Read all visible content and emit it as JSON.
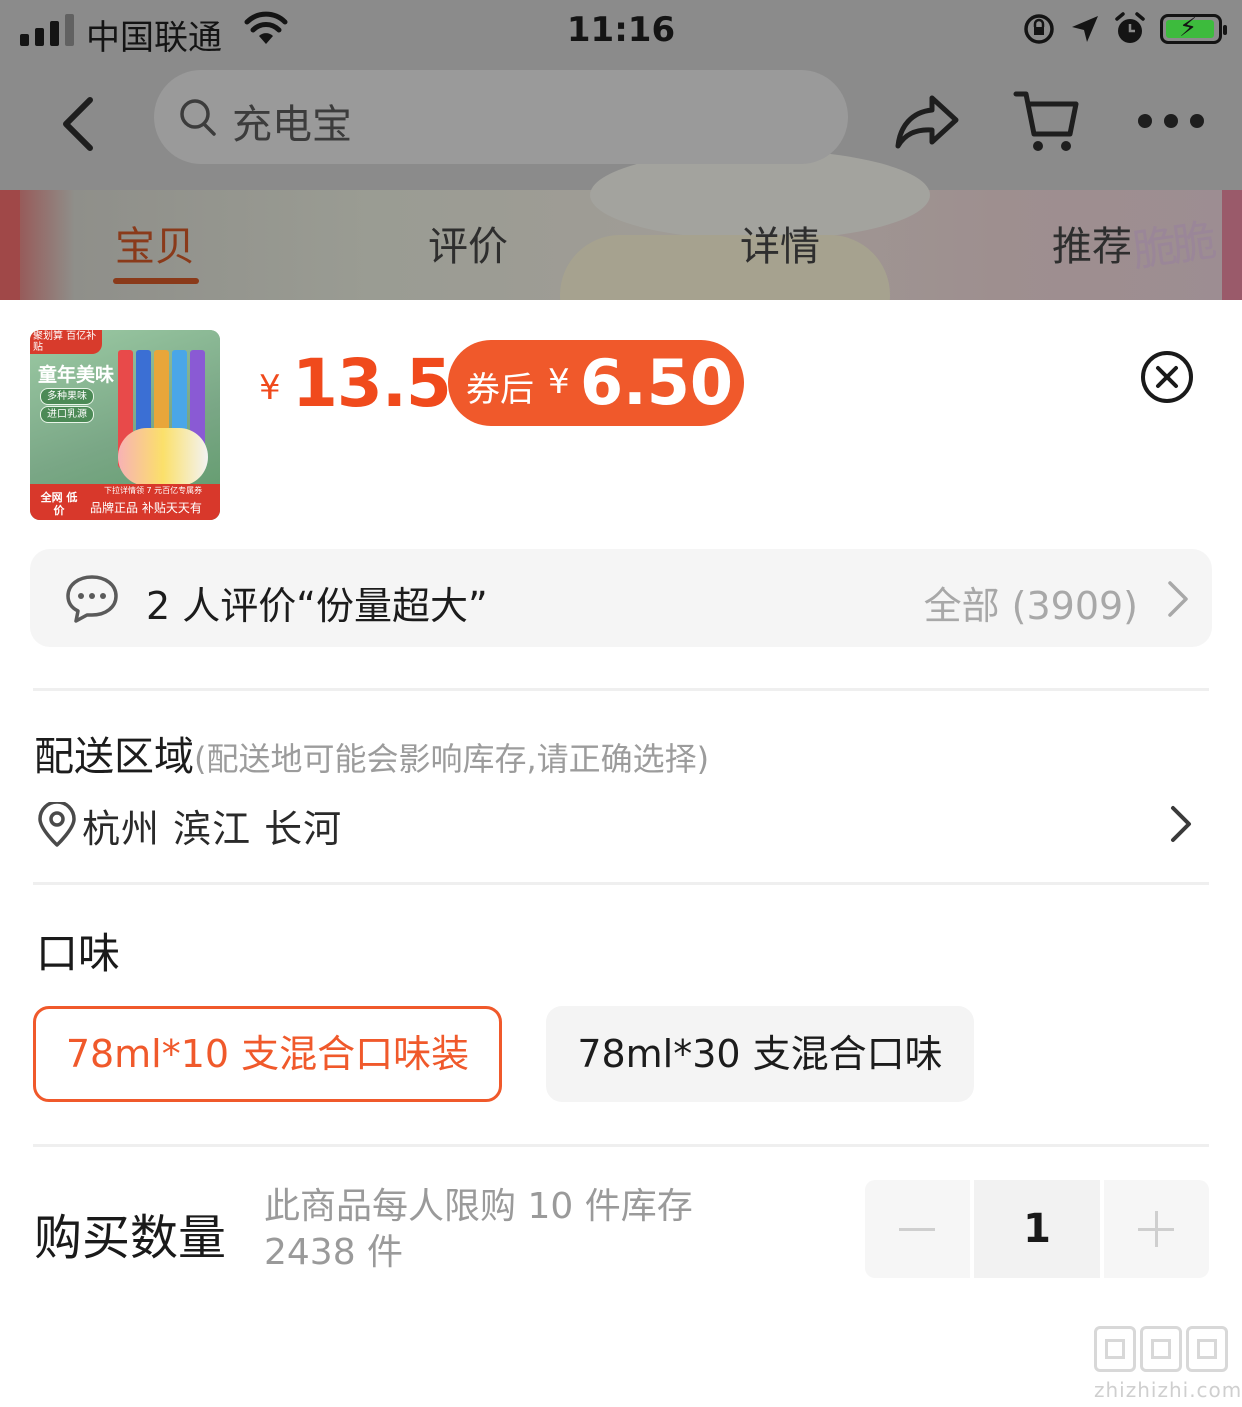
{
  "status_bar": {
    "carrier": "中国联通",
    "time": "11:16"
  },
  "header": {
    "search_placeholder": "充电宝"
  },
  "tabs": [
    {
      "label": "宝贝",
      "active": true
    },
    {
      "label": "评价",
      "active": false
    },
    {
      "label": "详情",
      "active": false
    },
    {
      "label": "推荐",
      "active": false
    }
  ],
  "banner": {
    "text": "脆脆"
  },
  "product_image": {
    "corner_badge": "聚划算 百亿补贴",
    "title": "童年美味",
    "tags": [
      "多种果味",
      "进口乳源"
    ],
    "bottom_left": "全网 低价",
    "bottom_right": "品牌正品 补贴天天有",
    "bottom_tip": "下拉详情领 7 元百亿专属券"
  },
  "price": {
    "currency": "¥",
    "original": "13.5",
    "coupon_label": "券后",
    "coupon_currency": "¥",
    "coupon_price": "6.50"
  },
  "review": {
    "summary": "2 人评价“份量超大”",
    "all_label": "全部 (3909)"
  },
  "delivery": {
    "title": "配送区域",
    "hint": "(配送地可能会影响库存,请正确选择)",
    "address": "杭州 滨江 长河"
  },
  "flavor": {
    "title": "口味",
    "options": [
      {
        "label": "78ml*10 支混合口味装",
        "selected": true
      },
      {
        "label": "78ml*30 支混合口味",
        "selected": false
      }
    ]
  },
  "quantity": {
    "title": "购买数量",
    "hint": "此商品每人限购 10 件库存 2438 件",
    "value": "1"
  },
  "watermark": {
    "text": "zhizhizhi.com"
  },
  "colors": {
    "accent": "#f0592b",
    "price_red": "#f04a1c",
    "overlay": "#8b8b8b"
  }
}
